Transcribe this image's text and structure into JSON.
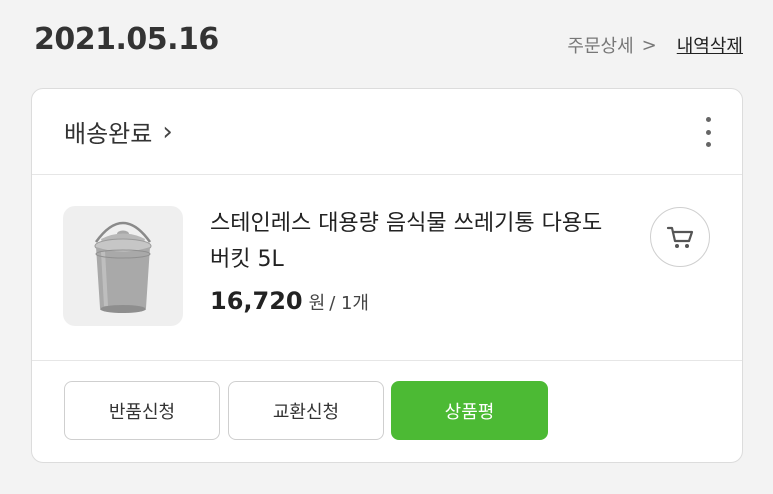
{
  "order": {
    "date": "2021.05.16",
    "detail_link": "주문상세",
    "delete_link": "내역삭제"
  },
  "card": {
    "status": "배송완료",
    "product": {
      "name": "스테인레스 대용량 음식물 쓰레기통 다용도 버킷 5L",
      "price": "16,720",
      "currency": "원",
      "quantity": "/ 1개"
    },
    "buttons": {
      "return_label": "반품신청",
      "exchange_label": "교환신청",
      "review_label": "상품평"
    }
  },
  "icons": {
    "detail_chevron": "chevron-right-icon",
    "status_chevron": "chevron-right-icon",
    "more_menu": "more-vertical-icon",
    "cart": "cart-icon"
  },
  "colors": {
    "background": "#f3f3f3",
    "primary_button": "#4cba34",
    "card_border": "#dcdcdc",
    "text": "#222222"
  }
}
